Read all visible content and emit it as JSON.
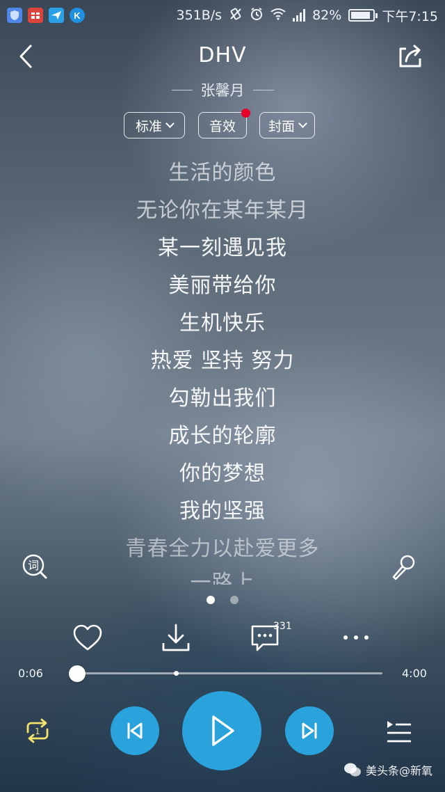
{
  "status_bar": {
    "net_speed": "351B/s",
    "battery_pct": "82%",
    "time": "下午7:15",
    "left_icons": [
      "shield-app-icon",
      "toolbox-app-icon",
      "plane-app-icon",
      "k-app-icon"
    ]
  },
  "header": {
    "title": "DHV",
    "artist": "张馨月",
    "chips": {
      "quality": "标准",
      "effects": "音效",
      "cover": "封面"
    }
  },
  "lyrics": [
    "生活的颜色",
    "无论你在某年某月",
    "某一刻遇见我",
    "美丽带给你",
    "生机快乐",
    "热爱 坚持 努力",
    "勾勒出我们",
    "成长的轮廓",
    "你的梦想",
    "我的坚强",
    "青春全力以赴爱更多",
    "一路上"
  ],
  "pager": {
    "pages": 2,
    "current": 1
  },
  "actions": {
    "comment_count": "331"
  },
  "progress": {
    "elapsed": "0:06",
    "duration": "4:00",
    "played_fraction": 0.025,
    "buffered_fraction": 0.34
  },
  "watermark": "美头条@新氧",
  "colors": {
    "accent": "#2aa2dc",
    "repeat": "#f2e36b",
    "badge_red": "#e8002a"
  }
}
